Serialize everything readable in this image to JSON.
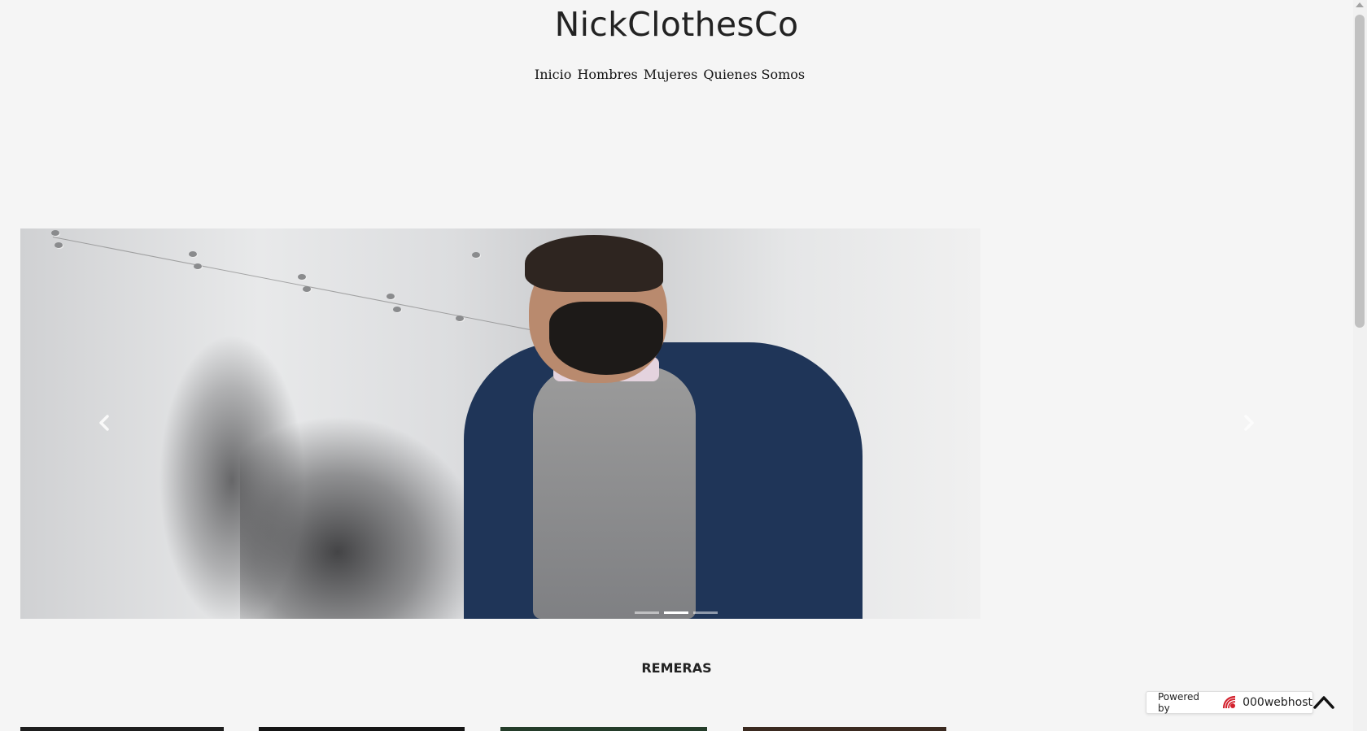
{
  "site": {
    "title": "NickClothesCo"
  },
  "nav": {
    "items": [
      {
        "label": "Inicio"
      },
      {
        "label": "Hombres"
      },
      {
        "label": "Mujeres"
      },
      {
        "label": "Quienes Somos"
      }
    ]
  },
  "carousel": {
    "slide_count": 3,
    "active_index": 1,
    "prev_icon": "chevron-left-icon",
    "next_icon": "chevron-right-icon"
  },
  "section": {
    "title": "REMERAS"
  },
  "product_cards": [
    {
      "color": "#1e1e1e"
    },
    {
      "color": "#151515"
    },
    {
      "color": "#243d2a"
    },
    {
      "color": "#3b2a20"
    }
  ],
  "badge": {
    "powered_by": "Powered by",
    "brand": "000webhost"
  },
  "back_to_top": {
    "icon": "chevron-up-icon"
  },
  "colors": {
    "background": "#f5f5f5",
    "jacket": "#1f3558",
    "text": "#222222"
  }
}
